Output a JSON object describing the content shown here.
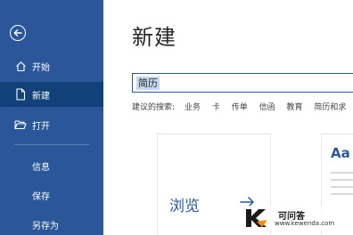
{
  "sidebar": {
    "items": [
      {
        "label": "开始",
        "icon": "home-icon"
      },
      {
        "label": "新建",
        "icon": "new-document-icon"
      },
      {
        "label": "打开",
        "icon": "folder-open-icon"
      },
      {
        "label": "信息"
      },
      {
        "label": "保存"
      },
      {
        "label": "另存为"
      }
    ]
  },
  "main": {
    "title": "新建",
    "search": {
      "value": "简历"
    },
    "suggested": {
      "label": "建议的搜索:",
      "terms": [
        "业务",
        "卡",
        "传单",
        "信函",
        "教育",
        "简历和求"
      ]
    },
    "templates": [
      {
        "label": "浏览"
      },
      {
        "label": "Aa"
      }
    ]
  },
  "watermark": {
    "name": "可问答",
    "url": "www.kewenda.com"
  },
  "colors": {
    "sidebar_bg": "#2b579a",
    "sidebar_active": "#124078",
    "accent": "#2b579a"
  }
}
